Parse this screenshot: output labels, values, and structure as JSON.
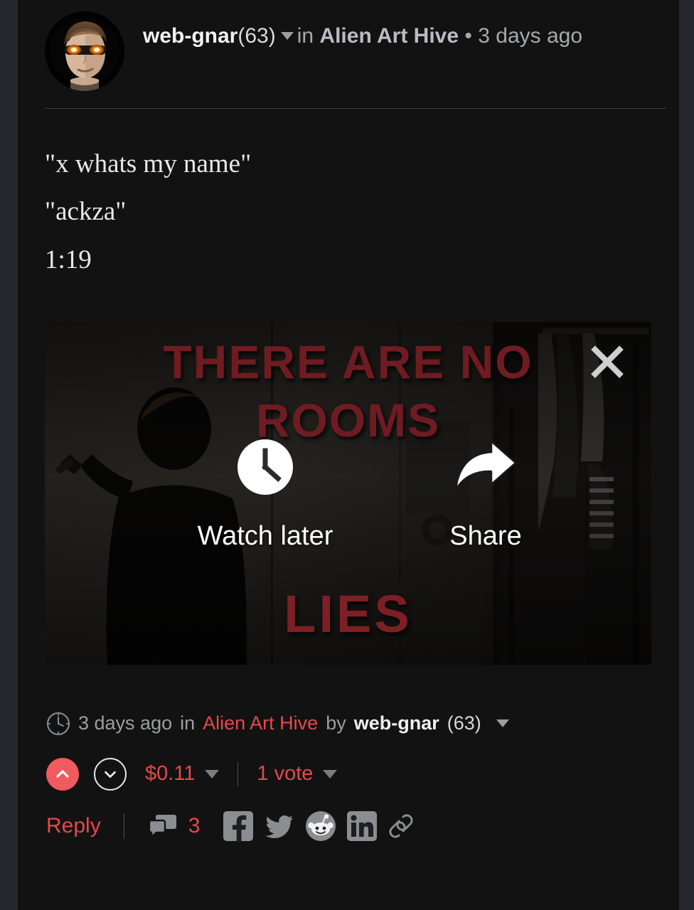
{
  "header": {
    "avatar_alt": "web-gnar avatar",
    "author": "web-gnar",
    "reputation": "(63)",
    "in_word": "in",
    "community": "Alien Art Hive",
    "bullet": "•",
    "timestamp": "3 days ago"
  },
  "body": {
    "line1": "\"x whats my name\"",
    "line2": "\"ackza\"",
    "line3": "1:19"
  },
  "video": {
    "overlay_line1": "THERE ARE NO",
    "overlay_line2": "ROOMS",
    "overlay_line3": "LIES",
    "watch_later_label": "Watch later",
    "share_label": "Share",
    "close_label": "Close"
  },
  "meta": {
    "timestamp": "3 days ago",
    "in_word": "in",
    "community": "Alien Art Hive",
    "by_word": "by",
    "author": "web-gnar",
    "reputation": "(63)"
  },
  "vote": {
    "payout": "$0.11",
    "votes": "1 vote"
  },
  "actions": {
    "reply": "Reply",
    "comment_count": "3",
    "social": [
      "facebook",
      "twitter",
      "reddit",
      "linkedin",
      "link"
    ]
  },
  "colors": {
    "accent_red": "#e5484d",
    "upvote_fill": "#f15a5f",
    "card_bg": "#121212",
    "page_bg": "#25272d",
    "overlay_red": "#6e1c22",
    "muted_text": "#9b9ea2"
  }
}
